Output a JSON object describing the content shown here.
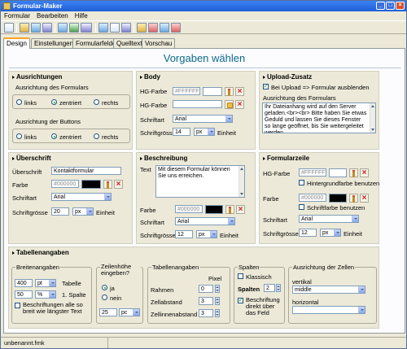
{
  "window": {
    "title": "Formular-Maker"
  },
  "menu": [
    "Formular",
    "Bearbeiten",
    "Hilfe"
  ],
  "toolbar_icons": [
    "new-file-icon",
    "open-folder-icon",
    "save-icon",
    "save-as-icon",
    "export-icon",
    "image-icon",
    "php-icon",
    "preview-icon",
    "open-icon",
    "settings-icon",
    "refresh-icon",
    "info-icon",
    "help-icon",
    "exit-icon"
  ],
  "tabs": [
    "Design",
    "Einstellungen",
    "Formularfelder",
    "Quelltext",
    "Vorschau (F9)"
  ],
  "heading": "Vorgaben wählen",
  "ausrichtungen": {
    "title": "Ausrichtungen",
    "formular_label": "Ausrichtung des Formulars",
    "buttons_label": "Ausrichtung der Buttons",
    "options": [
      "links",
      "zentriert",
      "rechts"
    ],
    "formular_selected": "zentriert",
    "buttons_selected": "zentriert"
  },
  "body": {
    "title": "Body",
    "hg_farbe_label": "HG-Farbe",
    "hg_farbe_value": "#FFFFFF",
    "hg_farbe2_label": "HG-Farbe",
    "schriftart_label": "Schriftart",
    "schriftart_value": "Arial",
    "schriftgroesse_label": "Schriftgrösse",
    "schriftgroesse_value": "14",
    "unit_value": "px",
    "einheit_label": "Einheit"
  },
  "upload": {
    "title": "Upload-Zusatz",
    "checkbox_label": "Bei Upload => Formular ausblenden",
    "ausrichtung_label": "Ausrichtung des Formulars",
    "text": "Ihr Dateianhang wird auf den Server geladen.<br><br> Bitte haben Sie etwas Geduld und lassen Sie dieses Fenster so lange geöffnet, bis Sie weitergeleitet werden."
  },
  "ueberschrift": {
    "title": "Überschrift",
    "ueberschrift_label": "Überschrift",
    "ueberschrift_value": "Kontaktformular",
    "farbe_label": "Farbe",
    "farbe_value": "#000000",
    "schriftart_label": "Schriftart",
    "schriftart_value": "Arial",
    "schriftgroesse_label": "Schriftgrösse",
    "schriftgroesse_value": "20",
    "unit_value": "px",
    "einheit_label": "Einheit"
  },
  "beschreibung": {
    "title": "Beschreibung",
    "text_label": "Text",
    "text_value": "Mit diesem Formular können Sie uns erreichen.",
    "farbe_label": "Farbe",
    "farbe_value": "#000000",
    "schriftart_label": "Schriftart",
    "schriftart_value": "Arial",
    "schriftgroesse_label": "Schriftgrösse",
    "schriftgroesse_value": "12",
    "unit_value": "px",
    "einheit_label": "Einheit"
  },
  "formularzeile": {
    "title": "Formularzeile",
    "hg_farbe_label": "HG-Farbe",
    "hg_farbe_value": "#FFFFFF",
    "hg_check_label": "Hintergrundfarbe benutzen",
    "farbe_label": "Farbe",
    "farbe_value": "#000000",
    "schrift_check_label": "Schriftfarbe benutzen",
    "schriftart_label": "Schriftart",
    "schriftart_value": "Arial",
    "schriftgroesse_label": "Schriftgrösse",
    "schriftgroesse_value": "12",
    "unit_value": "px",
    "einheit_label": "Einheit"
  },
  "tabellen": {
    "title": "Tabellenangaben",
    "breitenangaben": {
      "title": "Breitenangaben",
      "tabelle_value": "400",
      "tabelle_unit": "pt",
      "tabelle_label": "Tabelle",
      "spalte_value": "50",
      "spalte_unit": "%",
      "spalte_label": "1. Spalte",
      "check_label": "Beschriftungen alle so breit wie längster Text"
    },
    "zeilenhoehe": {
      "title": "Zeilenhöhe eingeben?",
      "options": [
        "ja",
        "nein"
      ],
      "selected": "ja",
      "value": "25",
      "unit": "pc"
    },
    "tabellenangaben": {
      "title": "Tabellenangaben",
      "pixel_label": "Pixel",
      "rows": [
        {
          "label": "Rahmen",
          "value": "0"
        },
        {
          "label": "Zellabstand",
          "value": "3"
        },
        {
          "label": "Zellinnenabstand",
          "value": "3"
        }
      ]
    },
    "spalten": {
      "title": "Spalten",
      "klassisch_label": "Klassisch",
      "spalten_label": "Spalten",
      "spalten_value": "2",
      "check_label": "Beschriftung direkt über das Feld"
    },
    "ausrichtung_zellen": {
      "title": "Ausrichtung der Zellen",
      "vertikal_label": "vertikal",
      "vertikal_value": "middle",
      "horizontal_label": "horizontal",
      "horizontal_value": ""
    }
  },
  "status": {
    "filename": "unbenannt.fmk"
  }
}
